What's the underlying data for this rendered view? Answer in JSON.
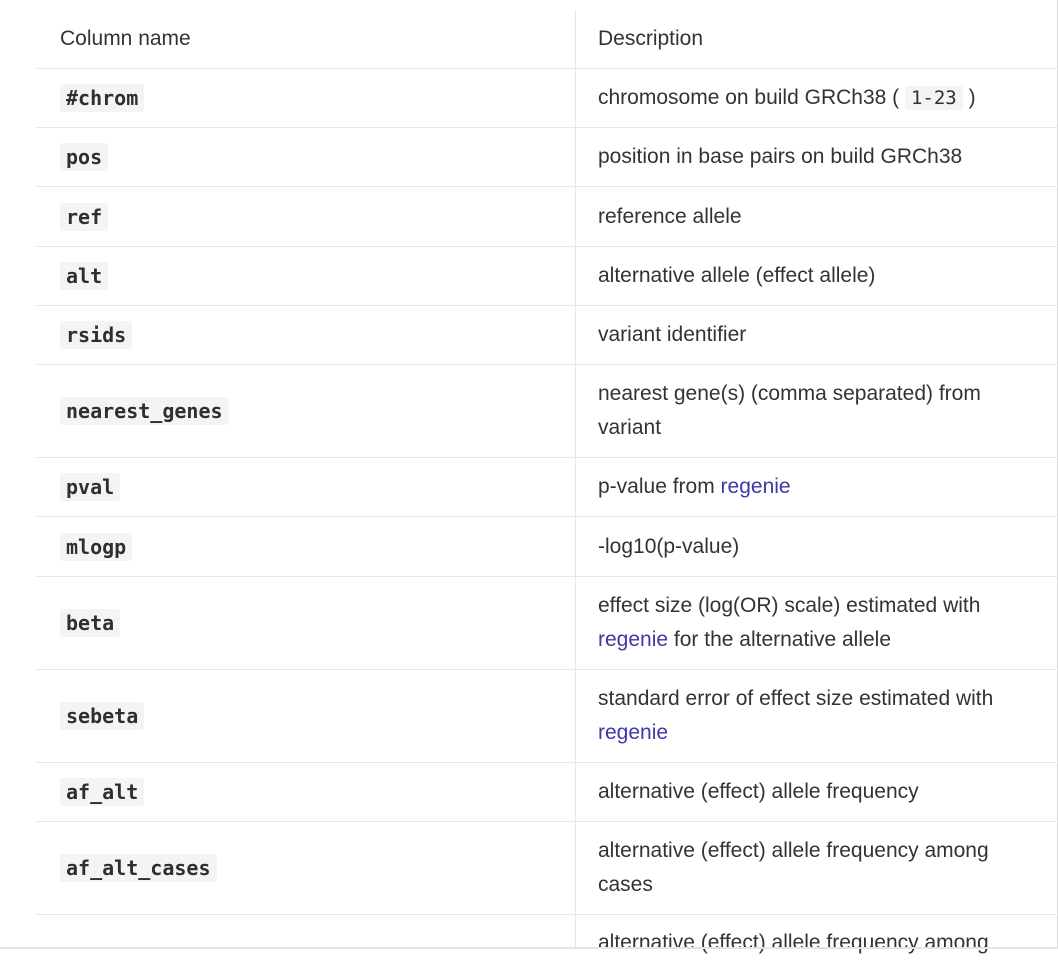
{
  "table": {
    "headers": {
      "name": "Column name",
      "description": "Description"
    },
    "rows": [
      {
        "name": "#chrom",
        "desc_pre": "chromosome on build GRCh38 (",
        "code": "1-23",
        "desc_post": ")"
      },
      {
        "name": "pos",
        "desc": "position in base pairs on build GRCh38"
      },
      {
        "name": "ref",
        "desc": "reference allele"
      },
      {
        "name": "alt",
        "desc": "alternative allele (effect allele)"
      },
      {
        "name": "rsids",
        "desc": "variant identifier"
      },
      {
        "name": "nearest_genes",
        "desc": "nearest gene(s) (comma separated) from variant"
      },
      {
        "name": "pval",
        "desc_pre": "p-value from ",
        "link": "regenie"
      },
      {
        "name": "mlogp",
        "desc": "-log10(p-value)"
      },
      {
        "name": "beta",
        "desc_pre": "effect size (log(OR) scale) estimated with ",
        "link": "regenie",
        "desc_post": " for the alternative allele"
      },
      {
        "name": "sebeta",
        "desc_pre": "standard error of effect size estimated with ",
        "link": "regenie"
      },
      {
        "name": "af_alt",
        "desc": "alternative (effect) allele frequency"
      },
      {
        "name": "af_alt_cases",
        "desc": "alternative (effect) allele frequency among cases"
      },
      {
        "name": "",
        "desc": "alternative (effect) allele frequency among"
      }
    ]
  },
  "colors": {
    "link": "#3d39a6",
    "divider": "#e8e8e8",
    "code_bg": "#f4f4f4"
  }
}
